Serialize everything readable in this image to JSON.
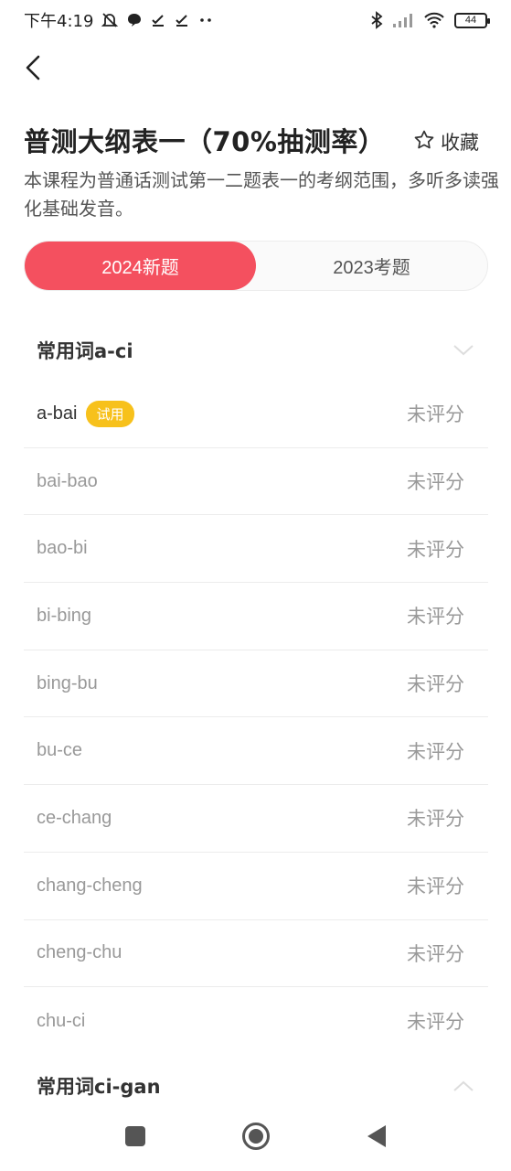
{
  "status_bar": {
    "time": "下午4:19",
    "battery": "44"
  },
  "header": {
    "title": "普测大纲表一（70%抽测率）",
    "favorite_label": "收藏",
    "description": "本课程为普通话测试第一二题表一的考纲范围，多听多读强化基础发音。"
  },
  "tabs": [
    {
      "label": "2024新题",
      "active": true
    },
    {
      "label": "2023考题",
      "active": false
    }
  ],
  "sections": [
    {
      "title": "常用词a-ci",
      "expanded": true,
      "items": [
        {
          "name": "a-bai",
          "badge": "试用",
          "status": "未评分"
        },
        {
          "name": "bai-bao",
          "status": "未评分"
        },
        {
          "name": "bao-bi",
          "status": "未评分"
        },
        {
          "name": "bi-bing",
          "status": "未评分"
        },
        {
          "name": "bing-bu",
          "status": "未评分"
        },
        {
          "name": "bu-ce",
          "status": "未评分"
        },
        {
          "name": "ce-chang",
          "status": "未评分"
        },
        {
          "name": "chang-cheng",
          "status": "未评分"
        },
        {
          "name": "cheng-chu",
          "status": "未评分"
        },
        {
          "name": "chu-ci",
          "status": "未评分"
        }
      ]
    },
    {
      "title": "常用词ci-gan",
      "expanded": false
    }
  ],
  "colors": {
    "accent": "#f4505f",
    "badge": "#f7c11c"
  },
  "icons": {
    "back": "back-arrow-icon",
    "favorite": "star-outline-icon",
    "section_open": "chevron-down-icon",
    "section_closed": "chevron-up-icon"
  }
}
